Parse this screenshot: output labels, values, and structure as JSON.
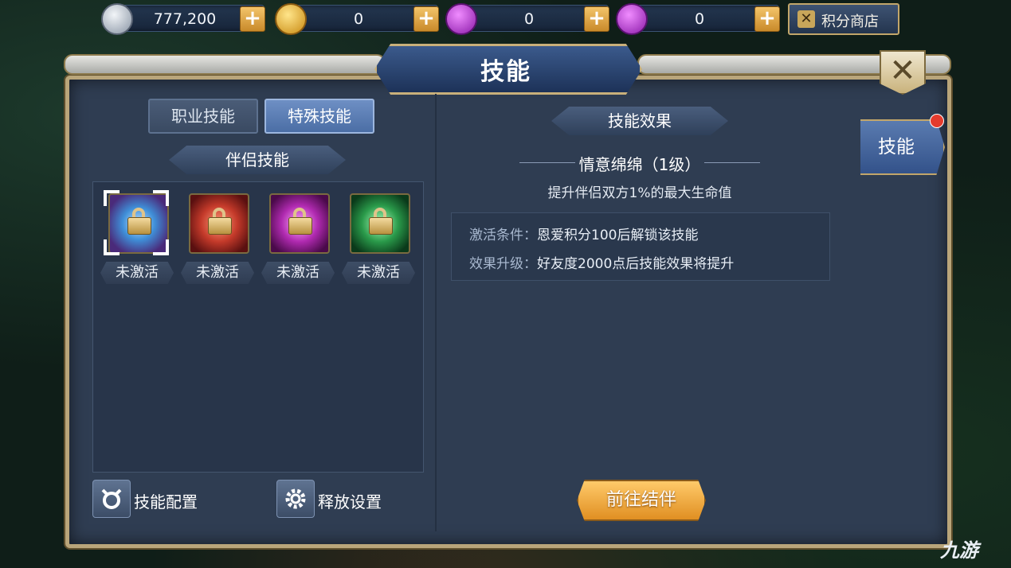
{
  "currencies": [
    {
      "name": "silver-coin",
      "value": "777,200",
      "color": "#b8c4d4"
    },
    {
      "name": "gold-coin",
      "value": "0",
      "color": "#e6b429"
    },
    {
      "name": "purple-bound-gem",
      "value": "0",
      "color": "#b03ad8"
    },
    {
      "name": "purple-gem",
      "value": "0",
      "color": "#b03ad8"
    }
  ],
  "plus_label": "+",
  "shop_button": {
    "label": "积分商店"
  },
  "window": {
    "title": "技能",
    "close_glyph": "✕"
  },
  "tabs": [
    {
      "label": "职业技能",
      "active": false
    },
    {
      "label": "特殊技能",
      "active": true
    }
  ],
  "partner_section": {
    "header": "伴侣技能"
  },
  "skills": [
    {
      "status": "未激活",
      "theme": "#3f8fd8",
      "selected": true
    },
    {
      "status": "未激活",
      "theme": "#c43a2a",
      "selected": false
    },
    {
      "status": "未激活",
      "theme": "#b02ab0",
      "selected": false
    },
    {
      "status": "未激活",
      "theme": "#2a9a4a",
      "selected": false
    }
  ],
  "bottom_buttons": [
    {
      "label": "技能配置",
      "icon": "skill-config-icon"
    },
    {
      "label": "释放设置",
      "icon": "gear-icon"
    }
  ],
  "effect_panel": {
    "header": "技能效果",
    "skill_name": "情意绵绵（1级）",
    "description": "提升伴侣双方1%的最大生命值",
    "conditions": [
      {
        "key": "激活条件：",
        "value": "恩爱积分100后解锁该技能"
      },
      {
        "key": "效果升级：",
        "value": "好友度2000点后技能效果将提升"
      }
    ],
    "action_button": "前往结伴"
  },
  "side_tab": {
    "label": "技能"
  },
  "watermark": "九游"
}
